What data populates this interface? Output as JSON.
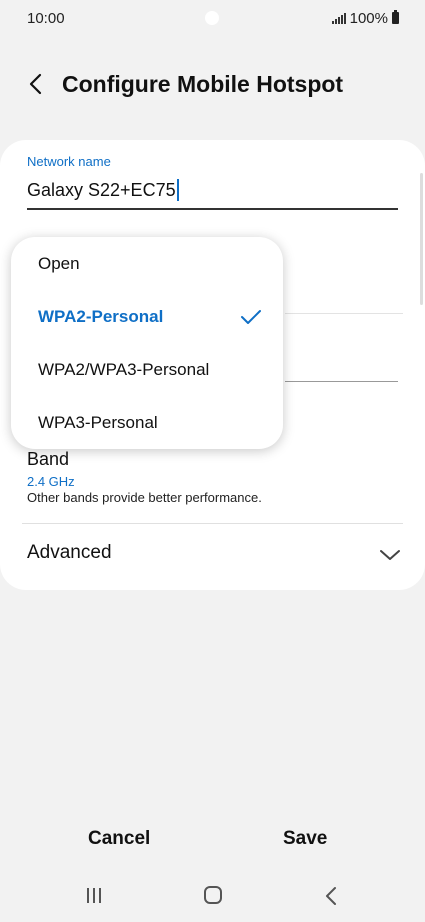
{
  "status_bar": {
    "time": "10:00",
    "battery": "100%"
  },
  "header": {
    "title": "Configure Mobile Hotspot"
  },
  "network_name": {
    "label": "Network name",
    "value": "Galaxy S22+EC75"
  },
  "security_dropdown": {
    "options": [
      {
        "label": "Open",
        "selected": false
      },
      {
        "label": "WPA2-Personal",
        "selected": true
      },
      {
        "label": "WPA2/WPA3-Personal",
        "selected": false
      },
      {
        "label": "WPA3-Personal",
        "selected": false
      }
    ]
  },
  "band": {
    "title": "Band",
    "value": "2.4 GHz",
    "description": "Other bands provide better performance."
  },
  "advanced": {
    "label": "Advanced"
  },
  "actions": {
    "cancel": "Cancel",
    "save": "Save"
  },
  "colors": {
    "accent": "#0f6fc6",
    "background": "#f2f2f2",
    "card": "#ffffff"
  },
  "icons": [
    "back-arrow-icon",
    "signal-icon",
    "battery-icon",
    "check-icon",
    "chevron-down-icon",
    "recents-icon",
    "home-icon",
    "nav-back-icon"
  ]
}
